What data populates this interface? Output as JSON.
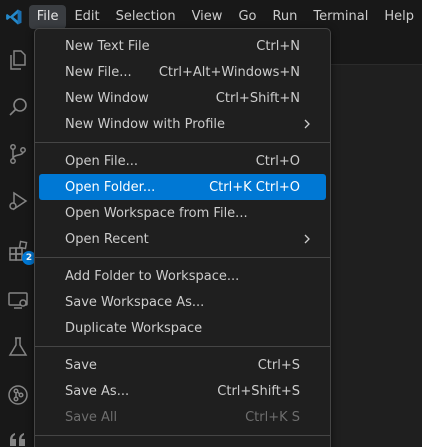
{
  "menubar": {
    "items": [
      {
        "label": "File",
        "active": true
      },
      {
        "label": "Edit"
      },
      {
        "label": "Selection"
      },
      {
        "label": "View"
      },
      {
        "label": "Go"
      },
      {
        "label": "Run"
      },
      {
        "label": "Terminal"
      },
      {
        "label": "Help"
      }
    ]
  },
  "activitybar": {
    "icons": [
      "explorer-icon",
      "search-icon",
      "source-control-icon",
      "run-debug-icon",
      "extensions-icon",
      "remote-explorer-icon",
      "testing-icon",
      "git-graph-icon",
      "quote-icon"
    ],
    "extensions_badge": "2"
  },
  "file_menu": {
    "group1": [
      {
        "label": "New Text File",
        "shortcut": "Ctrl+N"
      },
      {
        "label": "New File...",
        "shortcut": "Ctrl+Alt+Windows+N"
      },
      {
        "label": "New Window",
        "shortcut": "Ctrl+Shift+N"
      },
      {
        "label": "New Window with Profile",
        "submenu": true
      }
    ],
    "group2": [
      {
        "label": "Open File...",
        "shortcut": "Ctrl+O"
      },
      {
        "label": "Open Folder...",
        "shortcut": "Ctrl+K Ctrl+O",
        "highlighted": true
      },
      {
        "label": "Open Workspace from File..."
      },
      {
        "label": "Open Recent",
        "submenu": true
      }
    ],
    "group3": [
      {
        "label": "Add Folder to Workspace..."
      },
      {
        "label": "Save Workspace As..."
      },
      {
        "label": "Duplicate Workspace"
      }
    ],
    "group4": [
      {
        "label": "Save",
        "shortcut": "Ctrl+S"
      },
      {
        "label": "Save As...",
        "shortcut": "Ctrl+Shift+S"
      },
      {
        "label": "Save All",
        "shortcut": "Ctrl+K S",
        "disabled": true
      }
    ]
  },
  "colors": {
    "accent": "#0078d4",
    "background": "#1f1f1f",
    "menubar": "#181818",
    "text": "#cccccc",
    "disabled_text": "#6e6e6e"
  }
}
